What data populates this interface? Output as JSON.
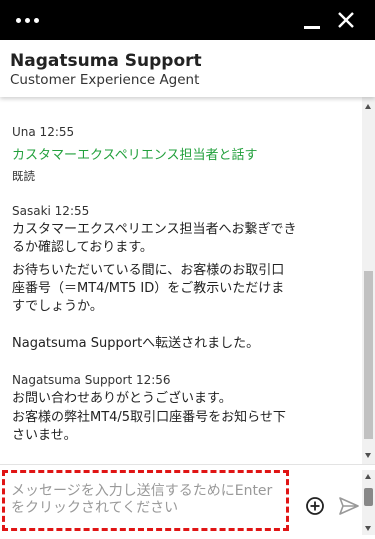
{
  "header": {
    "agent_name": "Nagatsuma Support",
    "agent_role": "Customer Experience Agent"
  },
  "messages": [
    {
      "meta": "Una 12:55",
      "text": "カスタマーエクスペリエンス担当者と話す",
      "status": "既読"
    },
    {
      "meta": "Sasaki 12:55",
      "text1": "カスタマーエクスペリエンス担当者へお繋ぎできるか確認しております。",
      "text2": "お待ちいただいている間に、お客様のお取引口座番号（＝MT4/MT5 ID）をご教示いただけますでしょうか。"
    },
    {
      "system": "Nagatsuma Supportへ転送されました。"
    },
    {
      "meta": "Nagatsuma Support 12:56",
      "text1": "お問い合わせありがとうございます。",
      "text2": "お客様の弊社MT4/5取引口座番号をお知らせ下さいませ。"
    }
  ],
  "composer": {
    "placeholder": "メッセージを入力し送信するためにEnterをクリックされてください"
  },
  "colors": {
    "titlebar": "#000000",
    "customer_text": "#22a03c",
    "input_border": "#e01414"
  },
  "icons": {
    "menu": "dots-menu-icon",
    "minimize": "minimize-icon",
    "close": "close-icon",
    "add": "plus-circle-icon",
    "send": "send-icon"
  }
}
